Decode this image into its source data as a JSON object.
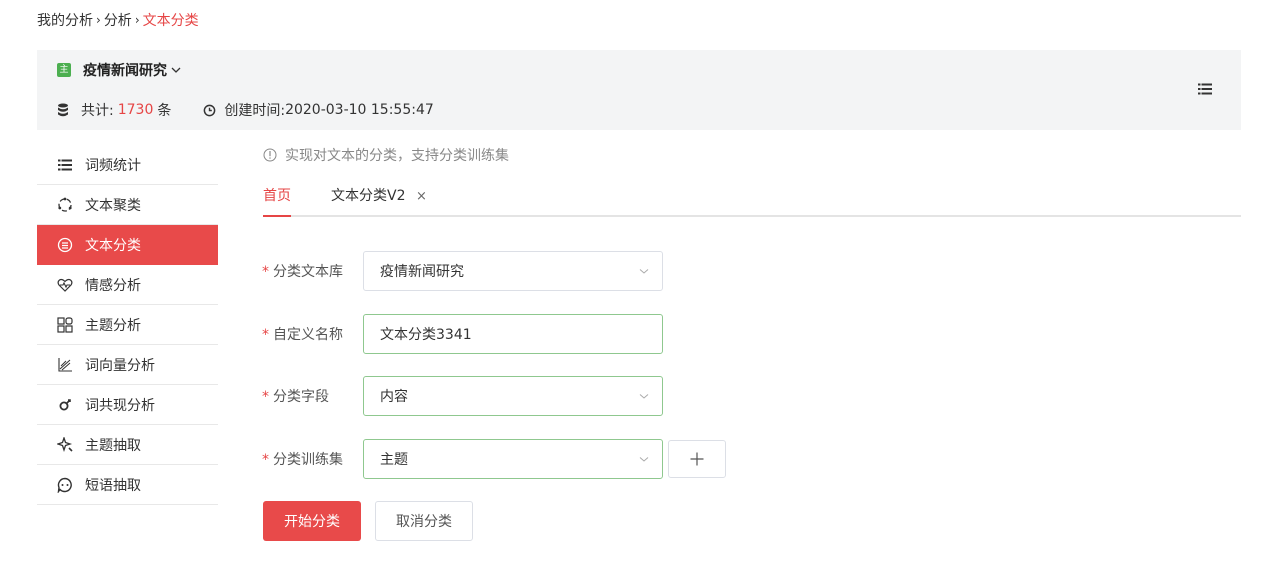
{
  "breadcrumb": {
    "items": [
      "我的分析",
      "分析"
    ],
    "current": "文本分类"
  },
  "header": {
    "badge": "主",
    "project_name": "疫情新闻研究",
    "total_label": "共计:",
    "total_count": "1730",
    "total_unit": "条",
    "created_label": "创建时间:",
    "created_time": "2020-03-10 15:55:47",
    "menu_icon": "list-icon"
  },
  "sidebar": {
    "items": [
      {
        "label": "词频统计",
        "icon": "list-icon"
      },
      {
        "label": "文本聚类",
        "icon": "cluster-icon"
      },
      {
        "label": "文本分类",
        "icon": "classify-icon",
        "active": true
      },
      {
        "label": "情感分析",
        "icon": "heart-pulse-icon"
      },
      {
        "label": "主题分析",
        "icon": "grid-icon"
      },
      {
        "label": "词向量分析",
        "icon": "vector-chart-icon"
      },
      {
        "label": "词共现分析",
        "icon": "link-icon"
      },
      {
        "label": "主题抽取",
        "icon": "sparkle-icon"
      },
      {
        "label": "短语抽取",
        "icon": "chat-icon"
      }
    ]
  },
  "main": {
    "tip": "实现对文本的分类，支持分类训练集",
    "tabs": [
      {
        "label": "首页"
      },
      {
        "label": "文本分类V2",
        "close": "×"
      }
    ],
    "form": {
      "fields": [
        {
          "label": "分类文本库",
          "value": "疫情新闻研究"
        },
        {
          "label": "自定义名称",
          "value": "文本分类3341"
        },
        {
          "label": "分类字段",
          "value": "内容"
        },
        {
          "label": "分类训练集",
          "value": "主题"
        }
      ],
      "required_mark": "*",
      "plus": "+"
    },
    "buttons": {
      "start": "开始分类",
      "cancel": "取消分类"
    }
  },
  "colors": {
    "accent": "#e84a4a",
    "valid_border": "#8fc88f",
    "badge": "#4caf50"
  }
}
